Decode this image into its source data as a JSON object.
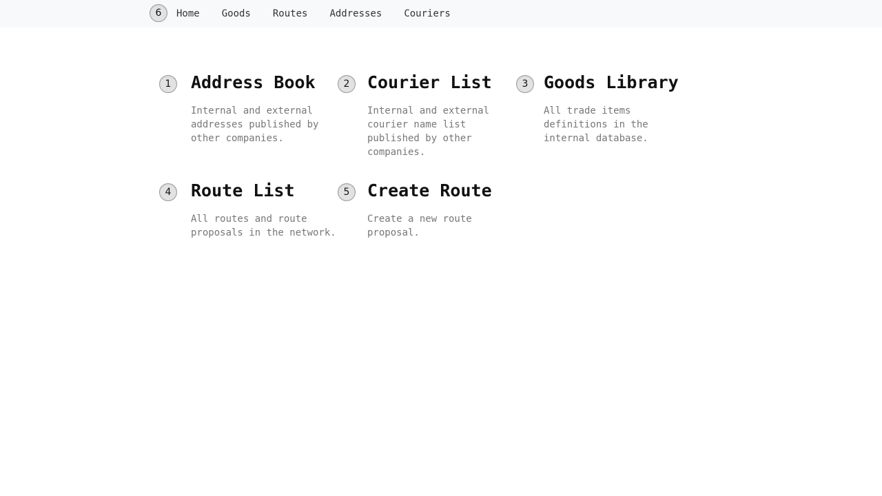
{
  "nav": {
    "badge": "6",
    "links": [
      "Home",
      "Goods",
      "Routes",
      "Addresses",
      "Couriers"
    ]
  },
  "cards": [
    {
      "badge": "1",
      "title": "Address Book",
      "description": "Internal and external addresses published by other companies."
    },
    {
      "badge": "2",
      "title": "Courier List",
      "description": "Internal and external courier name list published by other companies."
    },
    {
      "badge": "3",
      "title": "Goods Library",
      "description": "All trade items definitions in the internal database."
    },
    {
      "badge": "4",
      "title": "Route List",
      "description": "All routes and route proposals in the network."
    },
    {
      "badge": "5",
      "title": "Create Route",
      "description": "Create a new route proposal."
    }
  ],
  "colors": {
    "topbar_bg": "#f8f9fa",
    "marker_bg": "#e2e2e2",
    "description_text": "#777777"
  }
}
